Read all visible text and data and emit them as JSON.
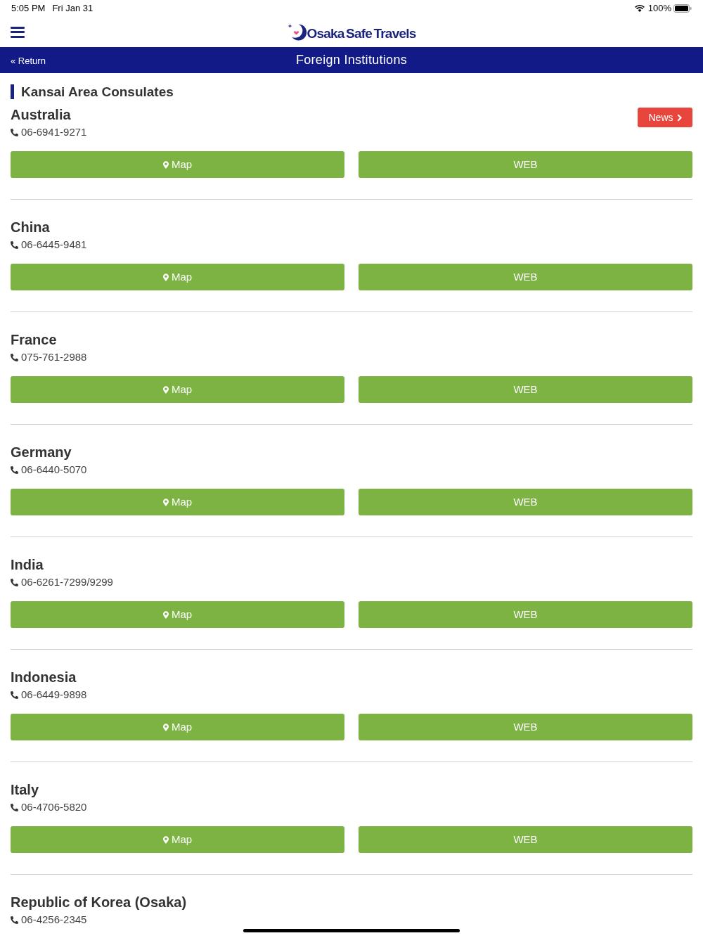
{
  "status_bar": {
    "time": "5:05 PM",
    "date": "Fri Jan 31",
    "battery": "100%"
  },
  "header": {
    "logo_text": "Osaka Safe Travels"
  },
  "nav_bar": {
    "back_link": "« Return",
    "title": "Foreign Institutions"
  },
  "section": {
    "title": "Kansai Area Consulates",
    "consulates": [
      {
        "name": "Australia",
        "phone": "06-6941-9271",
        "news": "News",
        "buttons": [
          {
            "kind": "map",
            "label": "Map"
          },
          {
            "kind": "web",
            "label": "WEB"
          }
        ]
      },
      {
        "name": "China",
        "phone": "06-6445-9481",
        "buttons": [
          {
            "kind": "map",
            "label": "Map"
          },
          {
            "kind": "web",
            "label": "WEB"
          }
        ]
      },
      {
        "name": "France",
        "phone": "075-761-2988",
        "buttons": [
          {
            "kind": "map",
            "label": "Map"
          },
          {
            "kind": "web",
            "label": "WEB"
          }
        ]
      },
      {
        "name": "Germany",
        "phone": "06-6440-5070",
        "buttons": [
          {
            "kind": "map",
            "label": "Map"
          },
          {
            "kind": "web",
            "label": "WEB"
          }
        ]
      },
      {
        "name": "India",
        "phone": "06-6261-7299/9299",
        "buttons": [
          {
            "kind": "map",
            "label": "Map"
          },
          {
            "kind": "web",
            "label": "WEB"
          }
        ]
      },
      {
        "name": "Indonesia",
        "phone": "06-6449-9898",
        "buttons": [
          {
            "kind": "map",
            "label": "Map"
          },
          {
            "kind": "web",
            "label": "WEB"
          }
        ]
      },
      {
        "name": "Italy",
        "phone": "06-4706-5820",
        "buttons": [
          {
            "kind": "map",
            "label": "Map"
          },
          {
            "kind": "web",
            "label": "WEB"
          }
        ]
      },
      {
        "name": "Republic of Korea (Osaka)",
        "phone": "06-4256-2345"
      }
    ]
  }
}
